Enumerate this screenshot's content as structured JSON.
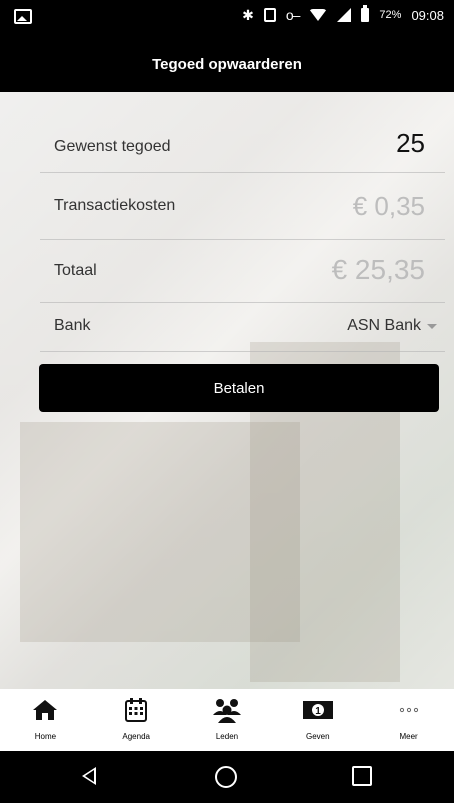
{
  "status_bar": {
    "battery_percent": "72%",
    "time": "09:08"
  },
  "header": {
    "title": "Tegoed opwaarderen"
  },
  "form": {
    "desired_credit_label": "Gewenst tegoed",
    "desired_credit_value": "25",
    "transaction_fee_label": "Transactiekosten",
    "transaction_fee_value": "€ 0,35",
    "total_label": "Totaal",
    "total_value": "€ 25,35",
    "bank_label": "Bank",
    "bank_value": "ASN Bank",
    "pay_button": "Betalen"
  },
  "tabbar": {
    "items": [
      {
        "label": "Home",
        "icon": "home-icon"
      },
      {
        "label": "Agenda",
        "icon": "calendar-icon"
      },
      {
        "label": "Leden",
        "icon": "members-icon"
      },
      {
        "label": "Geven",
        "icon": "give-icon"
      },
      {
        "label": "Meer",
        "icon": "more-icon"
      }
    ]
  },
  "colors": {
    "header_bg": "#000000",
    "button_bg": "#000000",
    "muted_value": "#bdbdbd"
  }
}
